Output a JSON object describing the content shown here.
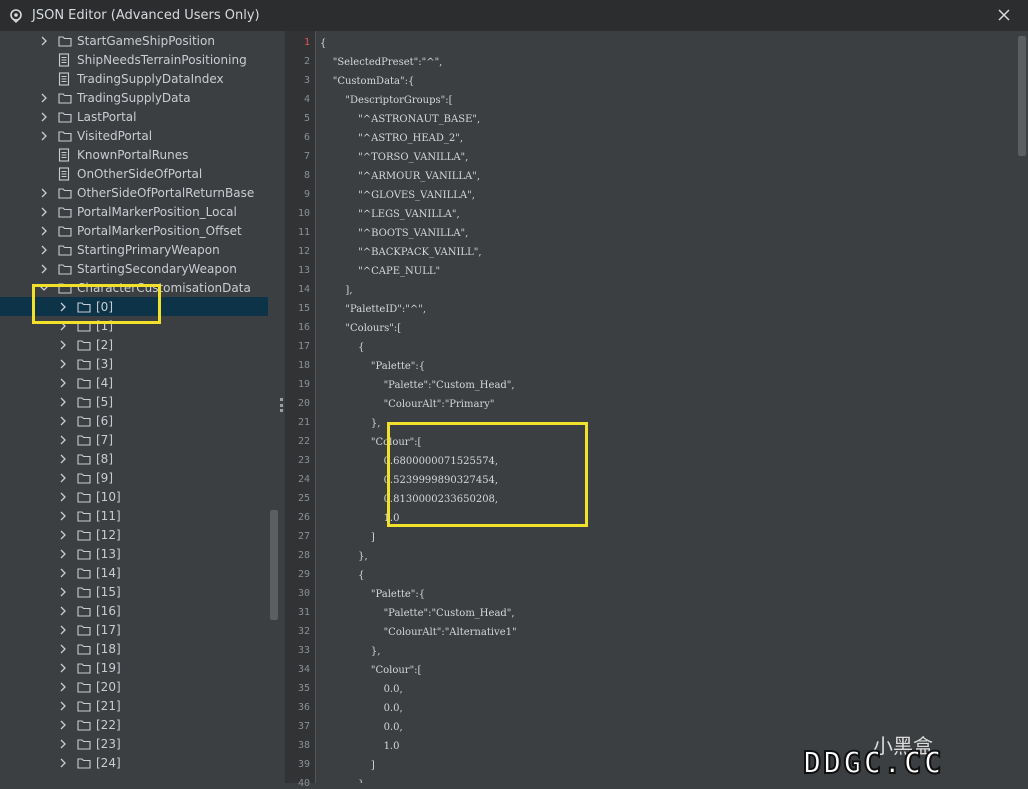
{
  "window": {
    "title": "JSON Editor (Advanced Users Only)"
  },
  "tree": {
    "items": [
      {
        "label": "StartGameShipPosition",
        "type": "folder",
        "expandable": true,
        "indent": 0
      },
      {
        "label": "ShipNeedsTerrainPositioning",
        "type": "file",
        "expandable": false,
        "indent": 0
      },
      {
        "label": "TradingSupplyDataIndex",
        "type": "file",
        "expandable": false,
        "indent": 0
      },
      {
        "label": "TradingSupplyData",
        "type": "folder",
        "expandable": true,
        "indent": 0
      },
      {
        "label": "LastPortal",
        "type": "folder",
        "expandable": true,
        "indent": 0
      },
      {
        "label": "VisitedPortal",
        "type": "folder",
        "expandable": true,
        "indent": 0
      },
      {
        "label": "KnownPortalRunes",
        "type": "file",
        "expandable": false,
        "indent": 0
      },
      {
        "label": "OnOtherSideOfPortal",
        "type": "file",
        "expandable": false,
        "indent": 0
      },
      {
        "label": "OtherSideOfPortalReturnBase",
        "type": "folder",
        "expandable": true,
        "indent": 0
      },
      {
        "label": "PortalMarkerPosition_Local",
        "type": "folder",
        "expandable": true,
        "indent": 0
      },
      {
        "label": "PortalMarkerPosition_Offset",
        "type": "folder",
        "expandable": true,
        "indent": 0
      },
      {
        "label": "StartingPrimaryWeapon",
        "type": "folder",
        "expandable": true,
        "indent": 0
      },
      {
        "label": "StartingSecondaryWeapon",
        "type": "folder",
        "expandable": true,
        "indent": 0
      },
      {
        "label": "CharacterCustomisationData",
        "type": "folder",
        "expandable": true,
        "indent": 0,
        "expanded": true
      },
      {
        "label": "[0]",
        "type": "folder",
        "expandable": true,
        "indent": 1,
        "selected": true
      },
      {
        "label": "[1]",
        "type": "folder",
        "expandable": true,
        "indent": 1
      },
      {
        "label": "[2]",
        "type": "folder",
        "expandable": true,
        "indent": 1
      },
      {
        "label": "[3]",
        "type": "folder",
        "expandable": true,
        "indent": 1
      },
      {
        "label": "[4]",
        "type": "folder",
        "expandable": true,
        "indent": 1
      },
      {
        "label": "[5]",
        "type": "folder",
        "expandable": true,
        "indent": 1
      },
      {
        "label": "[6]",
        "type": "folder",
        "expandable": true,
        "indent": 1
      },
      {
        "label": "[7]",
        "type": "folder",
        "expandable": true,
        "indent": 1
      },
      {
        "label": "[8]",
        "type": "folder",
        "expandable": true,
        "indent": 1
      },
      {
        "label": "[9]",
        "type": "folder",
        "expandable": true,
        "indent": 1
      },
      {
        "label": "[10]",
        "type": "folder",
        "expandable": true,
        "indent": 1
      },
      {
        "label": "[11]",
        "type": "folder",
        "expandable": true,
        "indent": 1
      },
      {
        "label": "[12]",
        "type": "folder",
        "expandable": true,
        "indent": 1
      },
      {
        "label": "[13]",
        "type": "folder",
        "expandable": true,
        "indent": 1
      },
      {
        "label": "[14]",
        "type": "folder",
        "expandable": true,
        "indent": 1
      },
      {
        "label": "[15]",
        "type": "folder",
        "expandable": true,
        "indent": 1
      },
      {
        "label": "[16]",
        "type": "folder",
        "expandable": true,
        "indent": 1
      },
      {
        "label": "[17]",
        "type": "folder",
        "expandable": true,
        "indent": 1
      },
      {
        "label": "[18]",
        "type": "folder",
        "expandable": true,
        "indent": 1
      },
      {
        "label": "[19]",
        "type": "folder",
        "expandable": true,
        "indent": 1
      },
      {
        "label": "[20]",
        "type": "folder",
        "expandable": true,
        "indent": 1
      },
      {
        "label": "[21]",
        "type": "folder",
        "expandable": true,
        "indent": 1
      },
      {
        "label": "[22]",
        "type": "folder",
        "expandable": true,
        "indent": 1
      },
      {
        "label": "[23]",
        "type": "folder",
        "expandable": true,
        "indent": 1
      },
      {
        "label": "[24]",
        "type": "folder",
        "expandable": true,
        "indent": 1
      }
    ]
  },
  "editor": {
    "lines": [
      "{",
      "    \"SelectedPreset\":\"^\",",
      "    \"CustomData\":{",
      "        \"DescriptorGroups\":[",
      "            \"^ASTRONAUT_BASE\",",
      "            \"^ASTRO_HEAD_2\",",
      "            \"^TORSO_VANILLA\",",
      "            \"^ARMOUR_VANILLA\",",
      "            \"^GLOVES_VANILLA\",",
      "            \"^LEGS_VANILLA\",",
      "            \"^BOOTS_VANILLA\",",
      "            \"^BACKPACK_VANILL\",",
      "            \"^CAPE_NULL\"",
      "        ],",
      "        \"PaletteID\":\"^\",",
      "        \"Colours\":[",
      "            {",
      "                \"Palette\":{",
      "                    \"Palette\":\"Custom_Head\",",
      "                    \"ColourAlt\":\"Primary\"",
      "                },",
      "                \"Colour\":[",
      "                    0.6800000071525574,",
      "                    0.5239999890327454,",
      "                    0.8130000233650208,",
      "                    1.0",
      "                ]",
      "            },",
      "            {",
      "                \"Palette\":{",
      "                    \"Palette\":\"Custom_Head\",",
      "                    \"ColourAlt\":\"Alternative1\"",
      "                },",
      "                \"Colour\":[",
      "                    0.0,",
      "                    0.0,",
      "                    0.0,",
      "                    1.0",
      "                ]",
      "            }"
    ],
    "active_line": 1
  },
  "watermark": {
    "cjk": "小黑盒",
    "text": "DDGC.CC"
  },
  "colors": {
    "highlight": "#f2e12a",
    "selection": "#0d3349",
    "error_marker": "#e25555"
  }
}
